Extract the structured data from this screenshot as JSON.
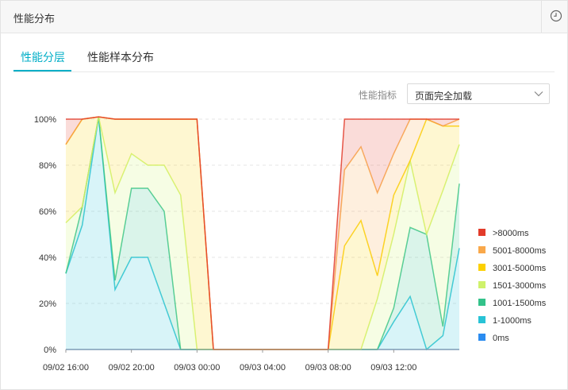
{
  "panel": {
    "title": "性能分布"
  },
  "tabs": [
    {
      "label": "性能分层",
      "active": true
    },
    {
      "label": "性能样本分布",
      "active": false
    }
  ],
  "filter": {
    "label": "性能指标",
    "selected": "页面完全加载"
  },
  "icons": {
    "history": "clock-icon",
    "dropdown": "chevron-down-icon"
  },
  "chart_data": {
    "type": "area",
    "stacked": true,
    "title": "",
    "xlabel": "",
    "ylabel": "",
    "ylim": [
      0,
      100
    ],
    "y_ticks": [
      "0%",
      "20%",
      "40%",
      "60%",
      "80%",
      "100%"
    ],
    "x_ticks": [
      "09/02 16:00",
      "09/02 20:00",
      "09/03 00:00",
      "09/03 04:00",
      "09/03 08:00",
      "09/03 12:00"
    ],
    "x_hours": [
      0,
      1,
      2,
      3,
      4,
      5,
      6,
      7,
      8,
      9,
      10,
      11,
      12,
      13,
      14,
      15,
      16,
      17,
      18,
      19,
      20,
      21,
      22,
      23,
      24
    ],
    "grid": true,
    "legend_position": "right",
    "series": [
      {
        "name": "0ms",
        "color": "#2b8cf0",
        "values": [
          0,
          0,
          0,
          0,
          0,
          0,
          0,
          0,
          0,
          0,
          0,
          0,
          0,
          0,
          0,
          0,
          0,
          0,
          0,
          0,
          0,
          0,
          0,
          0,
          0
        ]
      },
      {
        "name": "1-1000ms",
        "color": "#28c3d6",
        "values": [
          33,
          54,
          101,
          26,
          40,
          40,
          20,
          0,
          0,
          0,
          0,
          0,
          0,
          0,
          0,
          0,
          0,
          0,
          0,
          0,
          12,
          23,
          0,
          6,
          44,
          25
        ]
      },
      {
        "name": "1001-1500ms",
        "color": "#33c28a",
        "values": [
          0,
          8,
          0,
          4,
          30,
          30,
          40,
          0,
          0,
          0,
          0,
          0,
          0,
          0,
          0,
          0,
          0,
          0,
          0,
          0,
          6,
          30,
          50,
          4,
          28,
          29
        ]
      },
      {
        "name": "1501-3000ms",
        "color": "#cff26b",
        "values": [
          22,
          0,
          0,
          38,
          15,
          10,
          20,
          67,
          0,
          0,
          0,
          0,
          0,
          0,
          0,
          0,
          0,
          0,
          0,
          22,
          32,
          29,
          0,
          59,
          17,
          13
        ]
      },
      {
        "name": "3001-5000ms",
        "color": "#fcd000",
        "values": [
          34,
          38,
          0,
          32,
          15,
          20,
          20,
          33,
          100,
          0,
          0,
          0,
          0,
          0,
          0,
          0,
          0,
          45,
          56,
          10,
          17,
          0,
          50,
          28,
          8,
          20
        ]
      },
      {
        "name": "5001-8000ms",
        "color": "#f9a84a",
        "values": [
          0,
          0,
          0,
          0,
          0,
          0,
          0,
          0,
          0,
          0,
          0,
          0,
          0,
          0,
          0,
          0,
          0,
          33,
          32,
          36,
          18,
          18,
          0,
          0,
          3,
          0
        ]
      },
      {
        "name": ">8000ms",
        "color": "#e23b2a",
        "values": [
          11,
          0,
          0,
          0,
          0,
          0,
          0,
          0,
          0,
          0,
          0,
          0,
          0,
          0,
          0,
          0,
          0,
          22,
          12,
          32,
          15,
          0,
          0,
          3,
          0,
          13
        ]
      }
    ]
  }
}
